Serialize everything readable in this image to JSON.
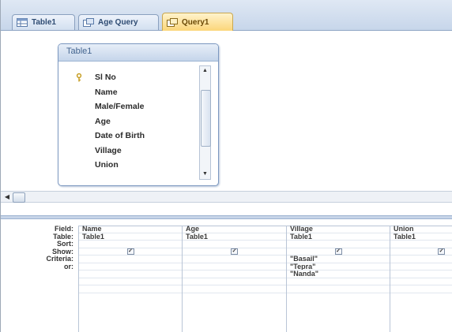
{
  "tabs": [
    {
      "label": "Table1",
      "icon": "table-icon",
      "active": false
    },
    {
      "label": "Age Query",
      "icon": "query-icon",
      "active": false
    },
    {
      "label": "Query1",
      "icon": "query-icon",
      "active": true
    }
  ],
  "table_box": {
    "title": "Table1",
    "fields": [
      "Sl No",
      "Name",
      "Male/Female",
      "Age",
      "Date of Birth",
      "Village",
      "Union"
    ],
    "primary_key_field": "Sl No"
  },
  "grid": {
    "row_labels": [
      "Field:",
      "Table:",
      "Sort:",
      "Show:",
      "Criteria:",
      "or:"
    ],
    "columns": [
      {
        "field": "Name",
        "table": "Table1",
        "show": true,
        "criteria": [
          "",
          "",
          ""
        ]
      },
      {
        "field": "Age",
        "table": "Table1",
        "show": true,
        "criteria": [
          "",
          "",
          ""
        ]
      },
      {
        "field": "Village",
        "table": "Table1",
        "show": true,
        "criteria": [
          "\"Basail\"",
          "\"Tepra\"",
          "\"Nanda\""
        ]
      },
      {
        "field": "Union",
        "table": "Table1",
        "show": true,
        "criteria": [
          "",
          "",
          ""
        ]
      }
    ]
  },
  "check_mark": "✓"
}
